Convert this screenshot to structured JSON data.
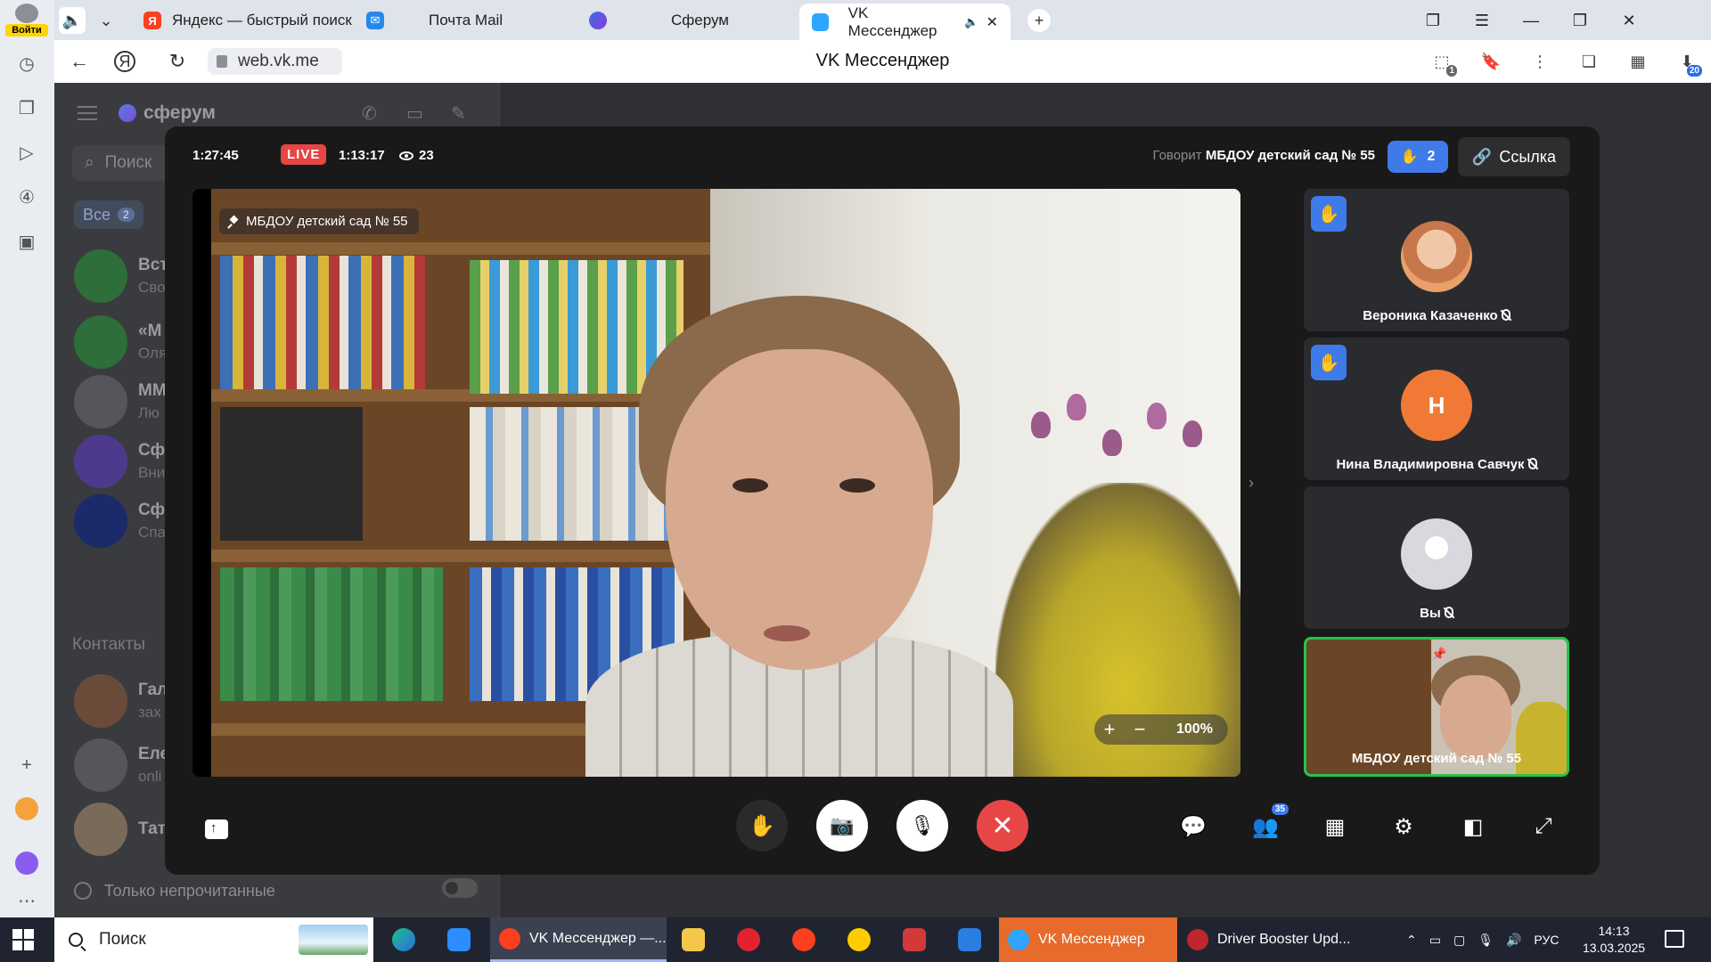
{
  "browser": {
    "login_label": "Войти",
    "tabs": [
      {
        "label": "Яндекс — быстрый поиск",
        "fav_color": "#fc3f1d",
        "fav_glyph": "Я"
      },
      {
        "label": "Почта Mail",
        "fav_color": "#2688eb",
        "fav_glyph": "✉"
      },
      {
        "label": "Сферум",
        "fav_color": "#6b4bd8",
        "fav_glyph": ""
      },
      {
        "label": "VK Мессенджер",
        "fav_color": "#2ea5ff",
        "fav_glyph": ""
      }
    ],
    "url": "web.vk.me",
    "page_title": "VK Мессенджер",
    "addr_badge_1": "1",
    "addr_badge_2": "20"
  },
  "sidebar": {
    "title": "сферум",
    "search_placeholder": "Поиск",
    "filter_label": "Все",
    "filter_count": "2",
    "chats": [
      {
        "name": "Вст",
        "sub": "Сво",
        "color": "#3a7d44"
      },
      {
        "name": "«М",
        "sub": "Оля",
        "color": "#3a7d44"
      },
      {
        "name": "ММ",
        "sub": "Лю",
        "color": "#55565a"
      },
      {
        "name": "Сф",
        "sub": "Вни",
        "color": "#4e3a8c"
      },
      {
        "name": "Сф",
        "sub": "Спа",
        "color": "#1b2a6a"
      }
    ],
    "contacts_title": "Контакты",
    "contacts": [
      {
        "name": "Гал",
        "sub": "зах",
        "color": "#6a4b3a"
      },
      {
        "name": "Еле",
        "sub": "onli",
        "color": "#55565a"
      },
      {
        "name": "Тат",
        "sub": "",
        "color": "#7a6a5a"
      }
    ],
    "unread_label": "Только непрочитанные"
  },
  "call": {
    "elapsed": "1:27:45",
    "live_label": "LIVE",
    "live_time": "1:13:17",
    "viewers": "23",
    "speaking_prefix": "Говорит",
    "speaking_name": "МБДОУ детский сад № 55",
    "raised_hands": "2",
    "link_label": "Ссылка",
    "pinned_name": "МБДОУ детский сад № 55",
    "zoom_plus": "+",
    "zoom_minus": "−",
    "zoom_level": "100%",
    "participants": [
      {
        "name": "Вероника Казаченко",
        "initial": "",
        "hand": true,
        "color": "#e0a070"
      },
      {
        "name": "Нина Владимировна Савчук",
        "initial": "Н",
        "hand": true,
        "color": "#f07a35"
      },
      {
        "name": "Вы",
        "initial": "",
        "hand": false,
        "color": "#d7d9df"
      },
      {
        "name": "МБДОУ детский сад № 55",
        "initial": "",
        "hand": false,
        "color": ""
      }
    ],
    "participants_count": "35"
  },
  "taskbar": {
    "search_label": "Поиск",
    "windows": [
      {
        "label": "VK Мессенджер —...",
        "color": "#fc3f1d"
      },
      {
        "label": "VK Мессенджер",
        "color": "#2ea5ff"
      },
      {
        "label": "Driver Booster Upd...",
        "color": "#c0262d"
      }
    ],
    "lang": "РУС",
    "time": "14:13",
    "date": "13.03.2025"
  }
}
